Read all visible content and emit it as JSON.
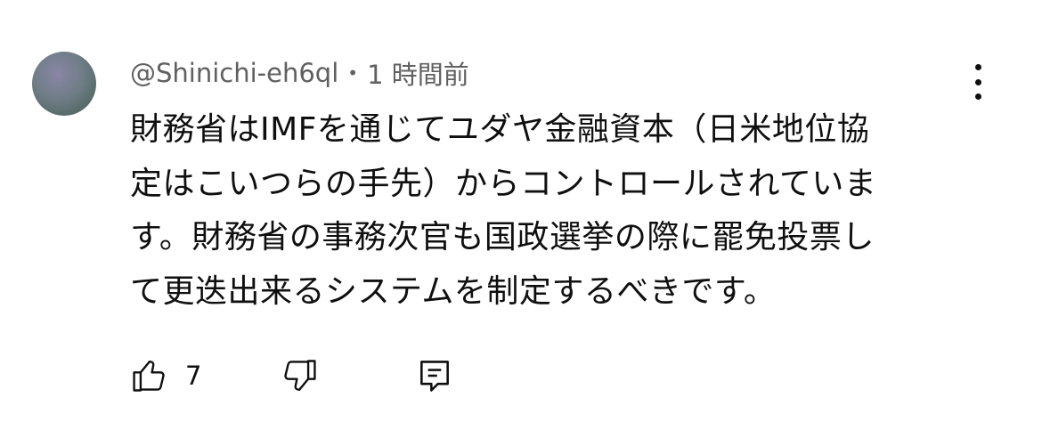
{
  "comment": {
    "author": "@Shinichi-eh6ql",
    "separator": "•",
    "timestamp": "1 時間前",
    "text_lines": [
      "財務省はIMFを通じてユダヤ金融資本（日米地位協",
      "定はこいつらの手先）からコントロールされていま",
      "す。財務省の事務次官も国政選挙の際に罷免投票し",
      "て更迭出来るシステムを制定するべきです。"
    ],
    "like_count": "7"
  },
  "icons": {
    "menu": "more-vert-icon",
    "like": "thumb-up-icon",
    "dislike": "thumb-down-icon",
    "reply": "comment-reply-icon"
  }
}
